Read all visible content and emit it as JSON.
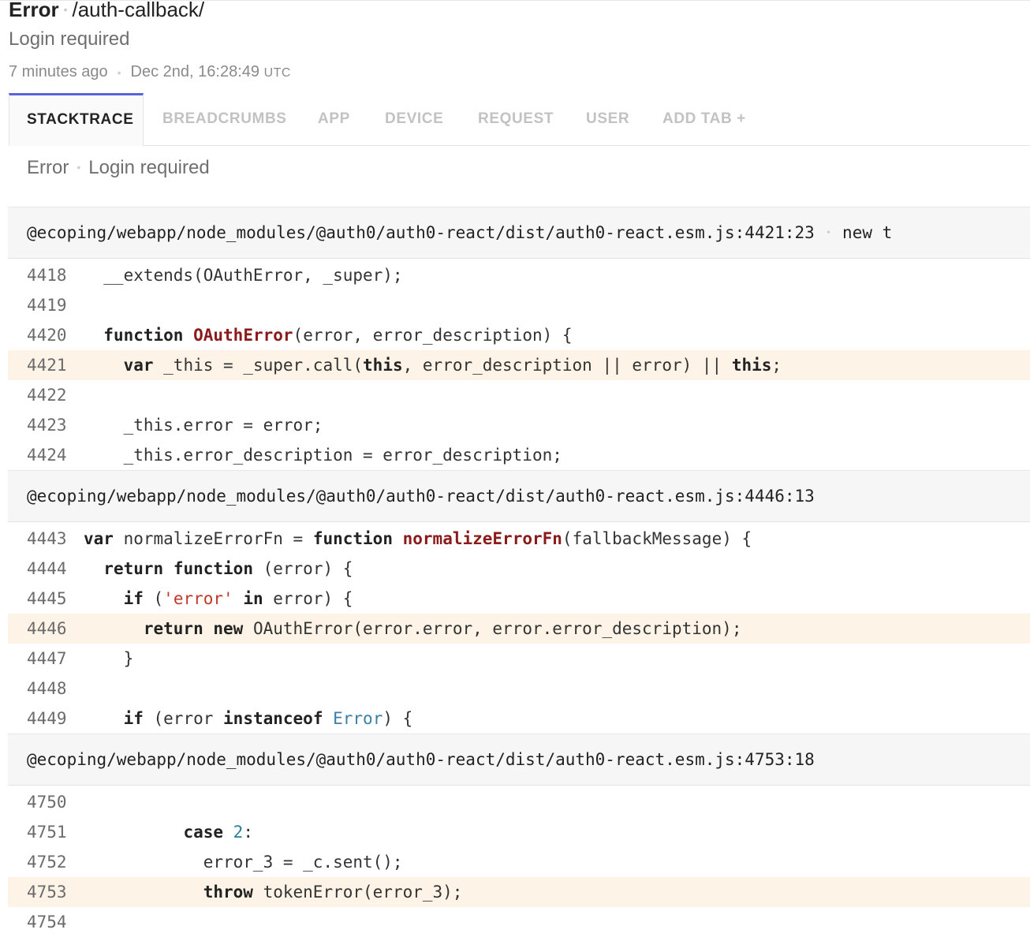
{
  "header": {
    "error_type": "Error",
    "context": "/auth-callback/",
    "message": "Login required",
    "relative_time": "7 minutes ago",
    "timestamp": "Dec 2nd, 16:28:49",
    "timezone": "UTC"
  },
  "tabs": [
    {
      "label": "STACKTRACE",
      "active": true
    },
    {
      "label": "BREADCRUMBS",
      "active": false
    },
    {
      "label": "APP",
      "active": false
    },
    {
      "label": "DEVICE",
      "active": false
    },
    {
      "label": "REQUEST",
      "active": false
    },
    {
      "label": "USER",
      "active": false
    },
    {
      "label": "ADD TAB +",
      "active": false
    }
  ],
  "exception": {
    "class": "Error",
    "message": "Login required"
  },
  "frames": [
    {
      "file": "@ecoping/webapp/node_modules/@auth0/auth0-react/dist/auth0-react.esm.js:4421:23",
      "method": "new t",
      "lines": [
        {
          "num": "4418",
          "highlight": false,
          "tokens": [
            {
              "t": "  __extends(OAuthError, _super);",
              "c": ""
            }
          ]
        },
        {
          "num": "4419",
          "highlight": false,
          "tokens": []
        },
        {
          "num": "4420",
          "highlight": false,
          "tokens": [
            {
              "t": "  ",
              "c": ""
            },
            {
              "t": "function",
              "c": "kw"
            },
            {
              "t": " ",
              "c": ""
            },
            {
              "t": "OAuthError",
              "c": "fn"
            },
            {
              "t": "(error, error_description) {",
              "c": ""
            }
          ]
        },
        {
          "num": "4421",
          "highlight": true,
          "tokens": [
            {
              "t": "    ",
              "c": ""
            },
            {
              "t": "var",
              "c": "kw"
            },
            {
              "t": " _this = _super.call(",
              "c": ""
            },
            {
              "t": "this",
              "c": "kw"
            },
            {
              "t": ", error_description || error) || ",
              "c": ""
            },
            {
              "t": "this",
              "c": "kw"
            },
            {
              "t": ";",
              "c": ""
            }
          ]
        },
        {
          "num": "4422",
          "highlight": false,
          "tokens": []
        },
        {
          "num": "4423",
          "highlight": false,
          "tokens": [
            {
              "t": "    _this.error = error;",
              "c": ""
            }
          ]
        },
        {
          "num": "4424",
          "highlight": false,
          "tokens": [
            {
              "t": "    _this.error_description = error_description;",
              "c": ""
            }
          ]
        }
      ]
    },
    {
      "file": "@ecoping/webapp/node_modules/@auth0/auth0-react/dist/auth0-react.esm.js:4446:13",
      "method": "",
      "lines": [
        {
          "num": "4443",
          "highlight": false,
          "tokens": [
            {
              "t": "var",
              "c": "kw"
            },
            {
              "t": " normalizeErrorFn = ",
              "c": ""
            },
            {
              "t": "function",
              "c": "kw"
            },
            {
              "t": " ",
              "c": ""
            },
            {
              "t": "normalizeErrorFn",
              "c": "fn"
            },
            {
              "t": "(fallbackMessage) {",
              "c": ""
            }
          ]
        },
        {
          "num": "4444",
          "highlight": false,
          "tokens": [
            {
              "t": "  ",
              "c": ""
            },
            {
              "t": "return",
              "c": "kw"
            },
            {
              "t": " ",
              "c": ""
            },
            {
              "t": "function",
              "c": "kw"
            },
            {
              "t": " (error) {",
              "c": ""
            }
          ]
        },
        {
          "num": "4445",
          "highlight": false,
          "tokens": [
            {
              "t": "    ",
              "c": ""
            },
            {
              "t": "if",
              "c": "kw"
            },
            {
              "t": " (",
              "c": ""
            },
            {
              "t": "'error'",
              "c": "str"
            },
            {
              "t": " ",
              "c": ""
            },
            {
              "t": "in",
              "c": "kw"
            },
            {
              "t": " error) {",
              "c": ""
            }
          ]
        },
        {
          "num": "4446",
          "highlight": true,
          "tokens": [
            {
              "t": "      ",
              "c": ""
            },
            {
              "t": "return",
              "c": "kw"
            },
            {
              "t": " ",
              "c": ""
            },
            {
              "t": "new",
              "c": "kw"
            },
            {
              "t": " OAuthError(error.error, error.error_description);",
              "c": ""
            }
          ]
        },
        {
          "num": "4447",
          "highlight": false,
          "tokens": [
            {
              "t": "    }",
              "c": ""
            }
          ]
        },
        {
          "num": "4448",
          "highlight": false,
          "tokens": []
        },
        {
          "num": "4449",
          "highlight": false,
          "tokens": [
            {
              "t": "    ",
              "c": ""
            },
            {
              "t": "if",
              "c": "kw"
            },
            {
              "t": " (error ",
              "c": ""
            },
            {
              "t": "instanceof",
              "c": "kw"
            },
            {
              "t": " ",
              "c": ""
            },
            {
              "t": "Error",
              "c": "blt"
            },
            {
              "t": ") {",
              "c": ""
            }
          ]
        }
      ]
    },
    {
      "file": "@ecoping/webapp/node_modules/@auth0/auth0-react/dist/auth0-react.esm.js:4753:18",
      "method": "",
      "lines": [
        {
          "num": "4750",
          "highlight": false,
          "tokens": []
        },
        {
          "num": "4751",
          "highlight": false,
          "tokens": [
            {
              "t": "          ",
              "c": ""
            },
            {
              "t": "case",
              "c": "kw"
            },
            {
              "t": " ",
              "c": ""
            },
            {
              "t": "2",
              "c": "num"
            },
            {
              "t": ":",
              "c": ""
            }
          ]
        },
        {
          "num": "4752",
          "highlight": false,
          "tokens": [
            {
              "t": "            error_3 = _c.sent();",
              "c": ""
            }
          ]
        },
        {
          "num": "4753",
          "highlight": true,
          "tokens": [
            {
              "t": "            ",
              "c": ""
            },
            {
              "t": "throw",
              "c": "kw"
            },
            {
              "t": " tokenError(error_3);",
              "c": ""
            }
          ]
        },
        {
          "num": "4754",
          "highlight": false,
          "tokens": []
        }
      ]
    }
  ],
  "colors": {
    "accent": "#5a63d8",
    "highlight_row": "#fdf4e7",
    "function_name": "#8b1a1a",
    "string": "#c0392b"
  }
}
